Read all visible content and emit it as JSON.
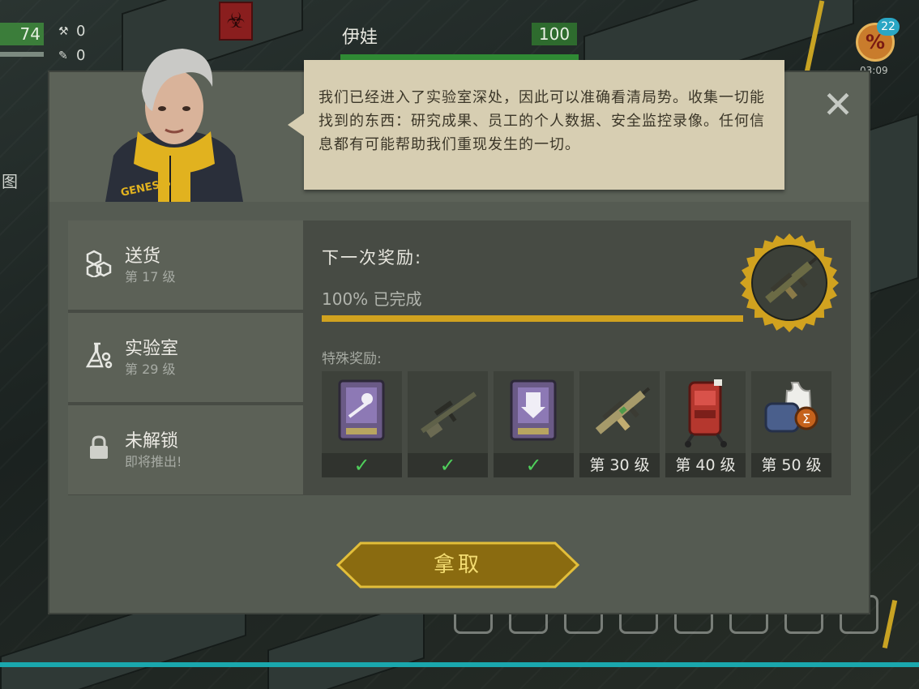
{
  "hud": {
    "player_level": "74",
    "stat_a": "0",
    "stat_b": "0",
    "character_name": "伊娃",
    "character_hp": "100",
    "promo_count": "22",
    "promo_symbol": "%",
    "promo_timer": "03:09",
    "map_label": "图"
  },
  "dialog": {
    "speech": "我们已经进入了实验室深处，因此可以准确看清局势。收集一切能找到的东西：研究成果、员工的个人数据、安全监控录像。任何信息都有可能帮助我们重现发生的一切。",
    "close_glyph": "✕",
    "menu": [
      {
        "title": "送货",
        "subtitle": "第 17 级",
        "icon": "boxes-icon"
      },
      {
        "title": "实验室",
        "subtitle": "第 29 级",
        "icon": "flask-icon"
      },
      {
        "title": "未解锁",
        "subtitle": "即将推出!",
        "icon": "lock-icon"
      }
    ],
    "next_reward_label": "下一次奖励:",
    "progress_text": "100% 已完成",
    "progress": 1.0,
    "special_label": "特殊奖励:",
    "slots": [
      {
        "item": "skull-card-item",
        "footer": "✓",
        "claimed": true
      },
      {
        "item": "sniper-rifle-item",
        "footer": "✓",
        "claimed": true
      },
      {
        "item": "arrow-card-item",
        "footer": "✓",
        "claimed": true
      },
      {
        "item": "assault-rifle-item",
        "footer": "第 30 级",
        "claimed": false
      },
      {
        "item": "red-backpack-item",
        "footer": "第 40 级",
        "claimed": false
      },
      {
        "item": "clothing-bundle-item",
        "footer": "第 50 级",
        "claimed": false
      }
    ],
    "claim_label": "拿取"
  },
  "colors": {
    "accent_gold": "#d1a21f",
    "check_green": "#4fcf5b",
    "speech_bg": "#d7ceb2"
  }
}
